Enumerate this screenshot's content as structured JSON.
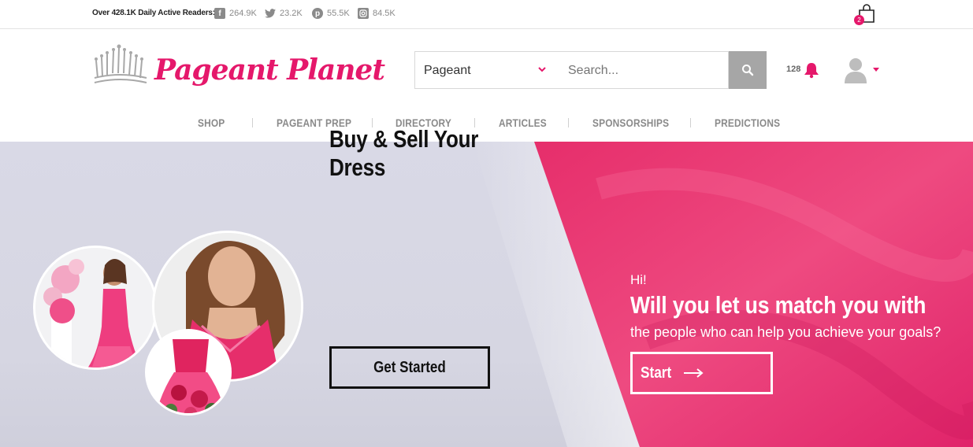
{
  "topbar": {
    "readers_text": "Over 428.1K Daily Active Readers:",
    "social": [
      {
        "icon": "facebook-icon",
        "count": "264.9K"
      },
      {
        "icon": "twitter-icon",
        "count": "23.2K"
      },
      {
        "icon": "pinterest-icon",
        "count": "55.5K"
      },
      {
        "icon": "instagram-icon",
        "count": "84.5K"
      }
    ],
    "cart_count": "2"
  },
  "header": {
    "logo_text": "Pageant Planet",
    "select_value": "Pageant",
    "search_placeholder": "Search...",
    "notification_count": "128"
  },
  "nav": {
    "items": [
      "SHOP",
      "PAGEANT PREP",
      "DIRECTORY",
      "ARTICLES",
      "SPONSORSHIPS",
      "PREDICTIONS"
    ]
  },
  "hero": {
    "left_headline": "Buy & Sell Your Dress",
    "left_button": "Get Started",
    "greeting": "Hi!",
    "right_title": "Will you let us match you with",
    "right_subtitle": "the people who can help you achieve your goals?",
    "right_button": "Start"
  },
  "colors": {
    "brand_pink": "#e5186b",
    "hero_pink": "#e8326f",
    "hero_lavender": "#d8d8e4",
    "nav_gray": "#8a8a8a"
  }
}
